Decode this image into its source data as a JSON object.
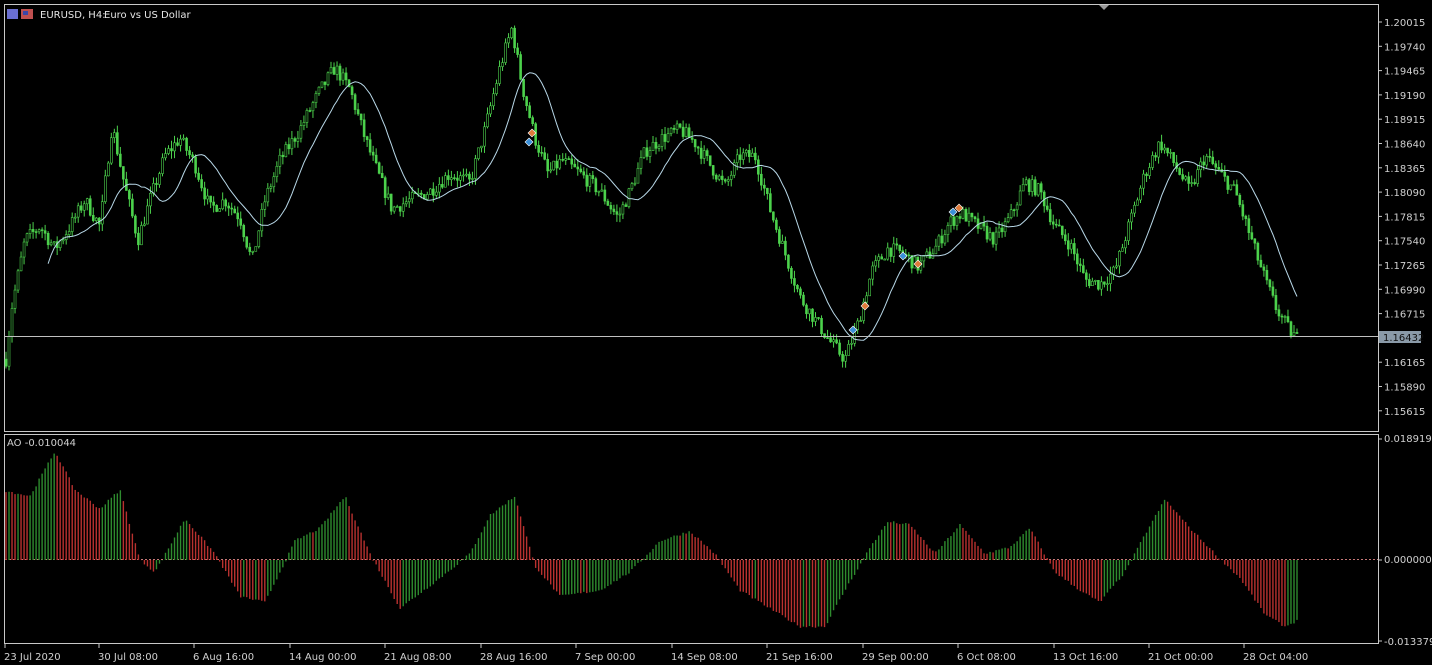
{
  "window": {
    "symbol": "EURUSD, H4:",
    "description": "Euro vs US Dollar"
  },
  "indicator": {
    "label": "AO -0.010044",
    "top_value": "0.018919",
    "zero_value": "0.000000",
    "bottom_value": "-0.013379"
  },
  "price_axis": {
    "ticks": [
      "1.20015",
      "1.19740",
      "1.19465",
      "1.19190",
      "1.18915",
      "1.18640",
      "1.18365",
      "1.18090",
      "1.17815",
      "1.17540",
      "1.17265",
      "1.16990",
      "1.16715",
      "1.16165",
      "1.15890",
      "1.15615"
    ],
    "current_price": "1.16432"
  },
  "time_axis": {
    "ticks": [
      "23 Jul 2020",
      "30 Jul 08:00",
      "6 Aug 16:00",
      "14 Aug 00:00",
      "21 Aug 08:00",
      "28 Aug 16:00",
      "7 Sep 00:00",
      "14 Sep 08:00",
      "21 Sep 16:00",
      "29 Sep 00:00",
      "6 Oct 08:00",
      "13 Oct 16:00",
      "21 Oct 00:00",
      "28 Oct 04:00"
    ]
  },
  "colors": {
    "background": "#000000",
    "candle": "#4cd24c",
    "ma_line": "#b8d8e8",
    "ao_up": "#2e8b2e",
    "ao_down": "#b8312f",
    "axis": "#d0d0d0",
    "grid_line": "#c0c0c0",
    "price_box": "#8a9aa8"
  },
  "chart_data": [
    {
      "type": "candlestick",
      "title": "EURUSD, H4: Euro vs US Dollar",
      "x": [
        "23 Jul 2020",
        "30 Jul 08:00",
        "6 Aug 16:00",
        "14 Aug 00:00",
        "21 Aug 08:00",
        "28 Aug 16:00",
        "7 Sep 00:00",
        "14 Sep 08:00",
        "21 Sep 16:00",
        "29 Sep 00:00",
        "6 Oct 08:00",
        "13 Oct 16:00",
        "21 Oct 00:00",
        "28 Oct 04:00"
      ],
      "close": [
        1.16,
        1.184,
        1.186,
        1.192,
        1.18,
        1.198,
        1.182,
        1.184,
        1.164,
        1.173,
        1.178,
        1.173,
        1.185,
        1.166
      ],
      "ylim": [
        1.1545,
        1.2025
      ],
      "last_price": 1.16432,
      "grid": false
    },
    {
      "type": "bar",
      "title": "AO",
      "ylim": [
        -0.013379,
        0.018919
      ],
      "x": [
        "23 Jul 2020",
        "30 Jul 08:00",
        "6 Aug 16:00",
        "14 Aug 00:00",
        "21 Aug 08:00",
        "28 Aug 16:00",
        "7 Sep 00:00",
        "14 Sep 08:00",
        "21 Sep 16:00",
        "29 Sep 00:00",
        "6 Oct 08:00",
        "13 Oct 16:00",
        "21 Oct 00:00",
        "28 Oct 04:00"
      ],
      "values": [
        0.011,
        0.006,
        0.0035,
        0.0025,
        -0.005,
        0.009,
        -0.004,
        0.003,
        -0.011,
        0.004,
        0.0035,
        -0.006,
        0.007,
        -0.01
      ],
      "last_value": -0.010044
    }
  ]
}
